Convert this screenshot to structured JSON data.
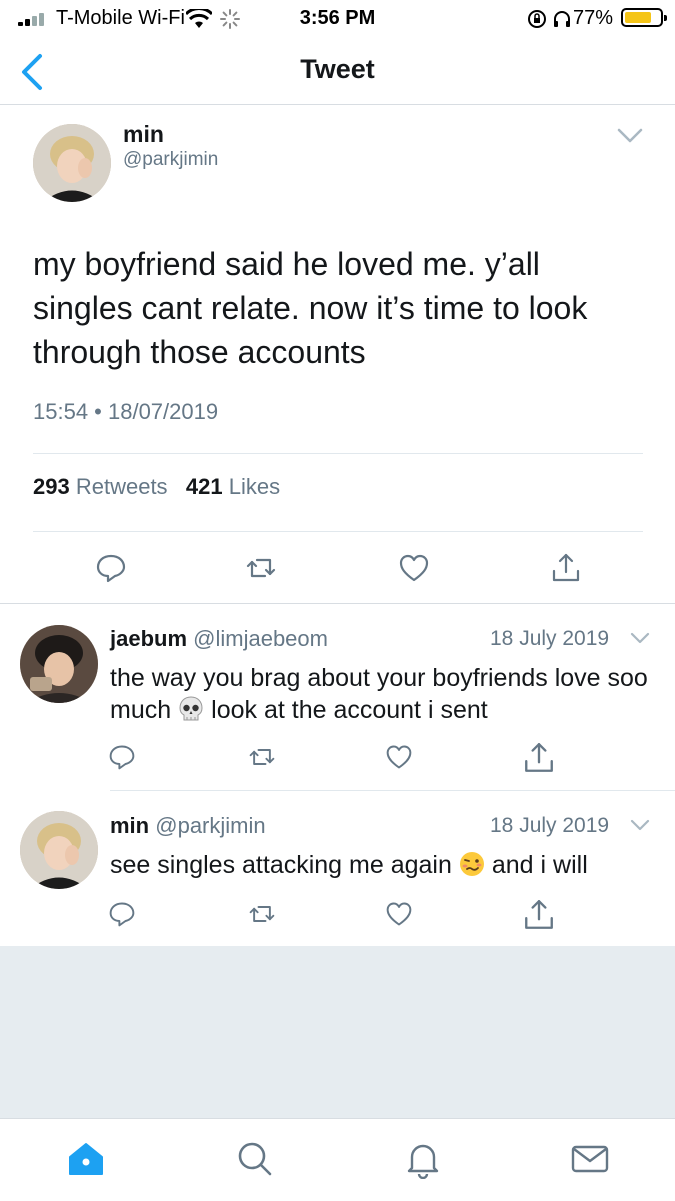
{
  "status_bar": {
    "carrier": "T-Mobile Wi-Fi",
    "time": "3:56 PM",
    "battery_percent": "77%",
    "battery_level": 0.77,
    "battery_color": "#f5c518"
  },
  "nav": {
    "title": "Tweet",
    "back_icon": "chevron-left-icon"
  },
  "main_tweet": {
    "name": "min",
    "handle": "@parkjimin",
    "text": "my boyfriend said he loved me. y’all singles cant relate. now it’s time to look through those accounts",
    "timestamp": "15:54 • 18/07/2019",
    "retweets_count": "293",
    "retweets_label": "Retweets",
    "likes_count": "421",
    "likes_label": "Likes"
  },
  "replies": [
    {
      "name": "jaebum",
      "handle": "@limjaebeom",
      "date": "18 July 2019",
      "text_before": "the way you brag about your boyfriends love soo much",
      "emoji": "skull-emoji",
      "text_after": "look at the account i sent"
    },
    {
      "name": "min",
      "handle": "@parkjimin",
      "date": "18 July 2019",
      "text_before": "see singles attacking me again",
      "emoji": "woozy-face-emoji",
      "text_after": "and i will"
    }
  ],
  "tab_bar": {
    "items": [
      "home-icon",
      "search-icon",
      "notifications-icon",
      "messages-icon"
    ],
    "active": "home-icon",
    "accent": "#1da1f2"
  },
  "colors": {
    "accent": "#1da1f2",
    "muted_text": "#657786",
    "divider": "#e1e8ed",
    "background_grey": "#e6ecf0"
  }
}
